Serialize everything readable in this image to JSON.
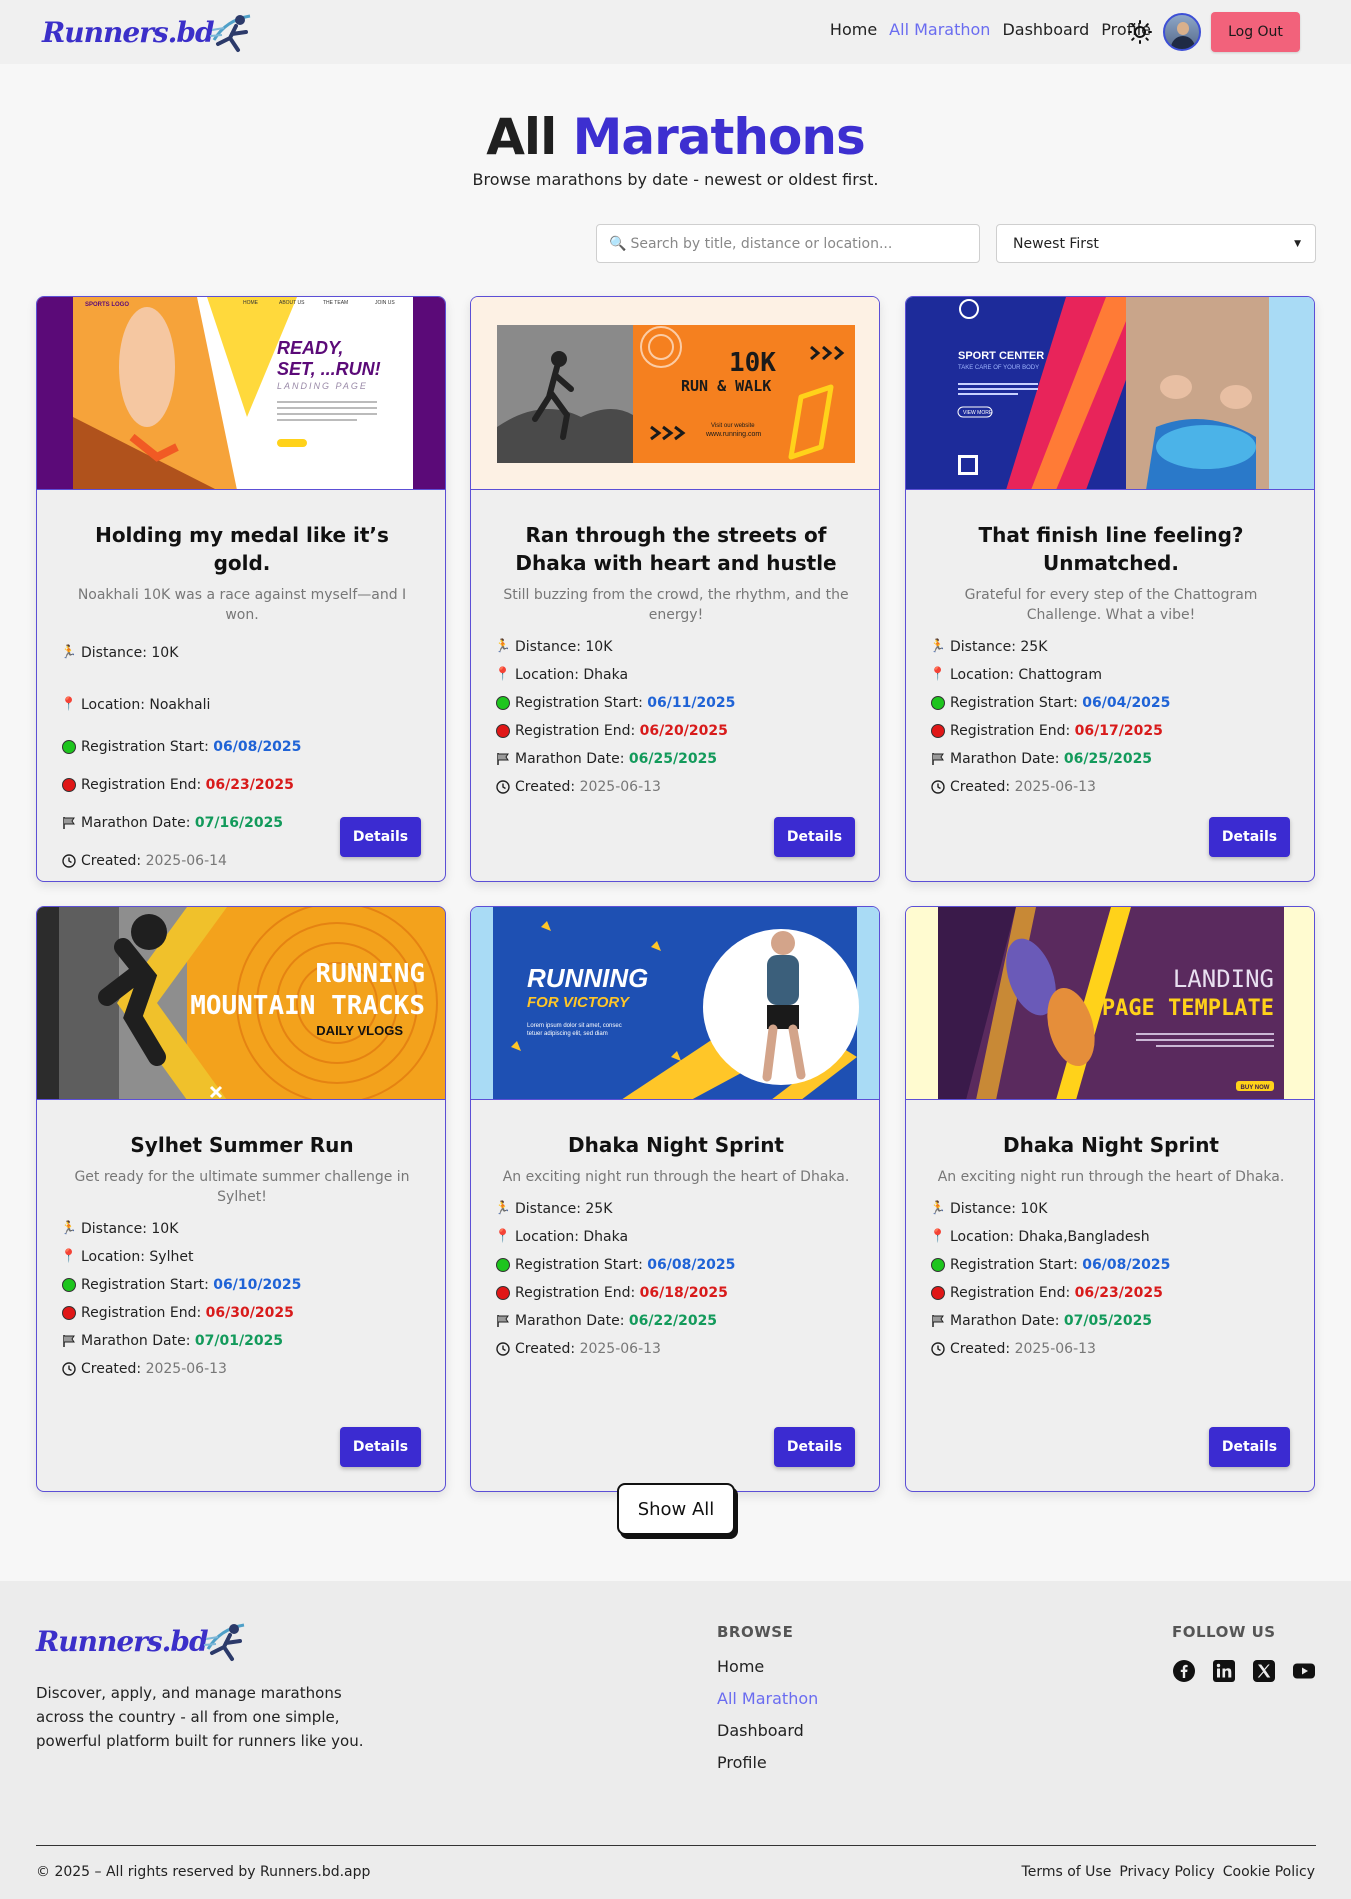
{
  "brand": {
    "logo_text": "Runners.bd"
  },
  "nav": {
    "links": [
      "Home",
      "All Marathon",
      "Dashboard",
      "Profile"
    ],
    "active_index": 1,
    "logout_label": "Log Out"
  },
  "header": {
    "title_plain": "All",
    "title_accent": "Marathons",
    "subtitle": "Browse marathons by date - newest or oldest first."
  },
  "controls": {
    "search_placeholder": "Search by title, distance or location...",
    "search_icon": "search-icon",
    "sort_selected": "Newest First"
  },
  "labels": {
    "distance": "Distance:",
    "location": "Location:",
    "reg_start": "Registration Start:",
    "reg_end": "Registration End:",
    "marathon_date": "Marathon Date:",
    "created": "Created:",
    "details": "Details"
  },
  "cards": [
    {
      "image_banner": [
        "READY,",
        "SET, ...RUN!",
        "LANDING PAGE",
        "SPORTS LOGO",
        "HOME",
        "ABOUT US",
        "THE TEAM",
        "JOIN US"
      ],
      "title": "Holding my medal like it’s gold.",
      "description": "Noakhali 10K was a race against myself—and I won.",
      "distance": "10K",
      "location": "Noakhali",
      "reg_start": "06/08/2025",
      "reg_end": "06/23/2025",
      "marathon_date": "07/16/2025",
      "created": "2025-06-14"
    },
    {
      "image_banner": [
        "10K",
        "RUN & WALK",
        "Visit our website",
        "www.running.com"
      ],
      "title": "Ran through the streets of Dhaka with heart and hustle",
      "description": "Still buzzing from the crowd, the rhythm, and the energy!",
      "distance": "10K",
      "location": "Dhaka",
      "reg_start": "06/11/2025",
      "reg_end": "06/20/2025",
      "marathon_date": "06/25/2025",
      "created": "2025-06-13"
    },
    {
      "image_banner": [
        "SPORT CENTER",
        "TAKE CARE OF YOUR BODY",
        "VIEW MORE"
      ],
      "title": "That finish line feeling? Unmatched.",
      "description": "Grateful for every step of the Chattogram Challenge. What a vibe!",
      "distance": "25K",
      "location": "Chattogram",
      "reg_start": "06/04/2025",
      "reg_end": "06/17/2025",
      "marathon_date": "06/25/2025",
      "created": "2025-06-13"
    },
    {
      "image_banner": [
        "RUNNING",
        "MOUNTAIN TRACKS",
        "DAILY VLOGS"
      ],
      "title": "Sylhet Summer Run",
      "description": "Get ready for the ultimate summer challenge in Sylhet!",
      "distance": "10K",
      "location": "Sylhet",
      "reg_start": "06/10/2025",
      "reg_end": "06/30/2025",
      "marathon_date": "07/01/2025",
      "created": "2025-06-13"
    },
    {
      "image_banner": [
        "RUNNING",
        "FOR VICTORY",
        "Lorem ipsum dolor sit amet, consec",
        "tetuer adipiscing elit, sed diam"
      ],
      "title": "Dhaka Night Sprint",
      "description": "An exciting night run through the heart of Dhaka.",
      "distance": "25K",
      "location": "Dhaka",
      "reg_start": "06/08/2025",
      "reg_end": "06/18/2025",
      "marathon_date": "06/22/2025",
      "created": "2025-06-13"
    },
    {
      "image_banner": [
        "LANDING",
        "PAGE TEMPLATE",
        "BUY NOW"
      ],
      "title": "Dhaka Night Sprint",
      "description": "An exciting night run through the heart of Dhaka.",
      "distance": "10K",
      "location": "Dhaka,Bangladesh",
      "reg_start": "06/08/2025",
      "reg_end": "06/23/2025",
      "marathon_date": "07/05/2025",
      "created": "2025-06-13"
    }
  ],
  "show_all_label": "Show All",
  "footer": {
    "logo_text": "Runners.bd",
    "description": "Discover, apply, and manage marathons across the country - all from one simple, powerful platform built for runners like you.",
    "browse_title": "BROWSE",
    "browse_links": [
      "Home",
      "All Marathon",
      "Dashboard",
      "Profile"
    ],
    "follow_title": "FOLLOW US",
    "social_icons": [
      "facebook-icon",
      "linkedin-icon",
      "x-icon",
      "youtube-icon"
    ],
    "copyright": "© 2025 – All rights reserved by Runners.bd.app",
    "legal_links": [
      "Terms of Use",
      "Privacy Policy",
      "Cookie Policy"
    ]
  },
  "colors": {
    "accent": "#3d2fd0",
    "logout": "#f2627b",
    "date_start": "#1f63d6",
    "date_end": "#d81b1b",
    "date_marathon": "#139a5b"
  }
}
